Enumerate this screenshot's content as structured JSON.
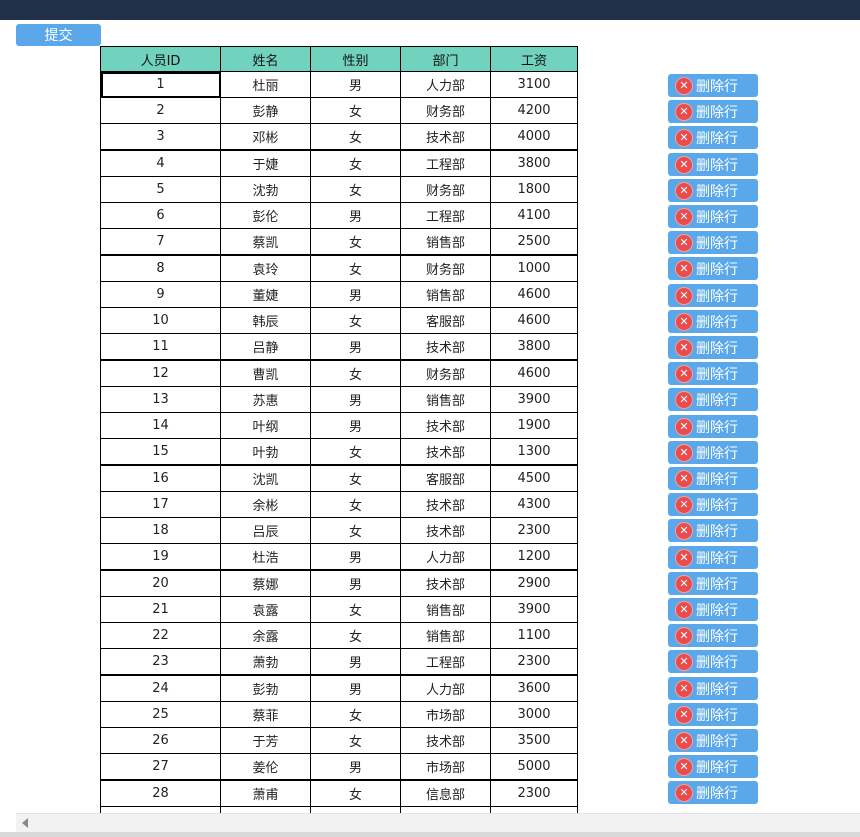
{
  "toolbar": {
    "submit_label": "提交"
  },
  "delete_label": "删除行",
  "delete_icon_glyph": "✕",
  "colors": {
    "header_bg": "#71d2bd",
    "button_bg": "#5aa8ea",
    "topbar": "#22304a",
    "delete_icon": "#e84c4c"
  },
  "table": {
    "columns": [
      "人员ID",
      "姓名",
      "性别",
      "部门",
      "工资"
    ],
    "rows": [
      [
        "1",
        "杜丽",
        "男",
        "人力部",
        "3100"
      ],
      [
        "2",
        "彭静",
        "女",
        "财务部",
        "4200"
      ],
      [
        "3",
        "邓彬",
        "女",
        "技术部",
        "4000"
      ],
      [
        "4",
        "于婕",
        "女",
        "工程部",
        "3800"
      ],
      [
        "5",
        "沈勃",
        "女",
        "财务部",
        "1800"
      ],
      [
        "6",
        "彭伦",
        "男",
        "工程部",
        "4100"
      ],
      [
        "7",
        "蔡凯",
        "女",
        "销售部",
        "2500"
      ],
      [
        "8",
        "袁玲",
        "女",
        "财务部",
        "1000"
      ],
      [
        "9",
        "董婕",
        "男",
        "销售部",
        "4600"
      ],
      [
        "10",
        "韩辰",
        "女",
        "客服部",
        "4600"
      ],
      [
        "11",
        "吕静",
        "男",
        "技术部",
        "3800"
      ],
      [
        "12",
        "曹凯",
        "女",
        "财务部",
        "4600"
      ],
      [
        "13",
        "苏惠",
        "男",
        "销售部",
        "3900"
      ],
      [
        "14",
        "叶纲",
        "男",
        "技术部",
        "1900"
      ],
      [
        "15",
        "叶勃",
        "女",
        "技术部",
        "1300"
      ],
      [
        "16",
        "沈凯",
        "女",
        "客服部",
        "4500"
      ],
      [
        "17",
        "余彬",
        "女",
        "技术部",
        "4300"
      ],
      [
        "18",
        "吕辰",
        "女",
        "技术部",
        "2300"
      ],
      [
        "19",
        "杜浩",
        "男",
        "人力部",
        "1200"
      ],
      [
        "20",
        "蔡娜",
        "男",
        "技术部",
        "2900"
      ],
      [
        "21",
        "袁露",
        "女",
        "销售部",
        "3900"
      ],
      [
        "22",
        "余露",
        "女",
        "销售部",
        "1100"
      ],
      [
        "23",
        "萧勃",
        "男",
        "工程部",
        "2300"
      ],
      [
        "24",
        "彭勃",
        "男",
        "人力部",
        "3600"
      ],
      [
        "25",
        "蔡菲",
        "女",
        "市场部",
        "3000"
      ],
      [
        "26",
        "于芳",
        "女",
        "技术部",
        "3500"
      ],
      [
        "27",
        "姜伦",
        "男",
        "市场部",
        "5000"
      ],
      [
        "28",
        "萧甫",
        "女",
        "信息部",
        "2300"
      ]
    ]
  }
}
